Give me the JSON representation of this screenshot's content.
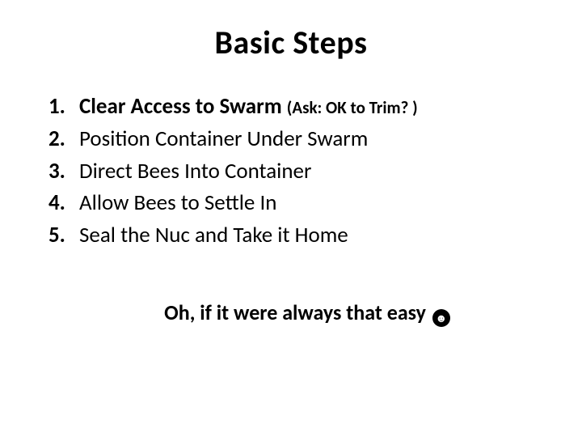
{
  "title": "Basic Steps",
  "items": [
    {
      "num": "1.",
      "bold": "Clear Access to Swarm ",
      "paren": "(Ask: OK to Trim? )"
    },
    {
      "num": "2.",
      "text": "Position Container Under Swarm"
    },
    {
      "num": "3.",
      "text": "Direct Bees Into Container"
    },
    {
      "num": "4.",
      "text": "Allow Bees to Settle In"
    },
    {
      "num": "5.",
      "text": "Seal the Nuc and Take it Home"
    }
  ],
  "footer": "Oh, if it were always that easy ",
  "emoji_glyph": "☻"
}
